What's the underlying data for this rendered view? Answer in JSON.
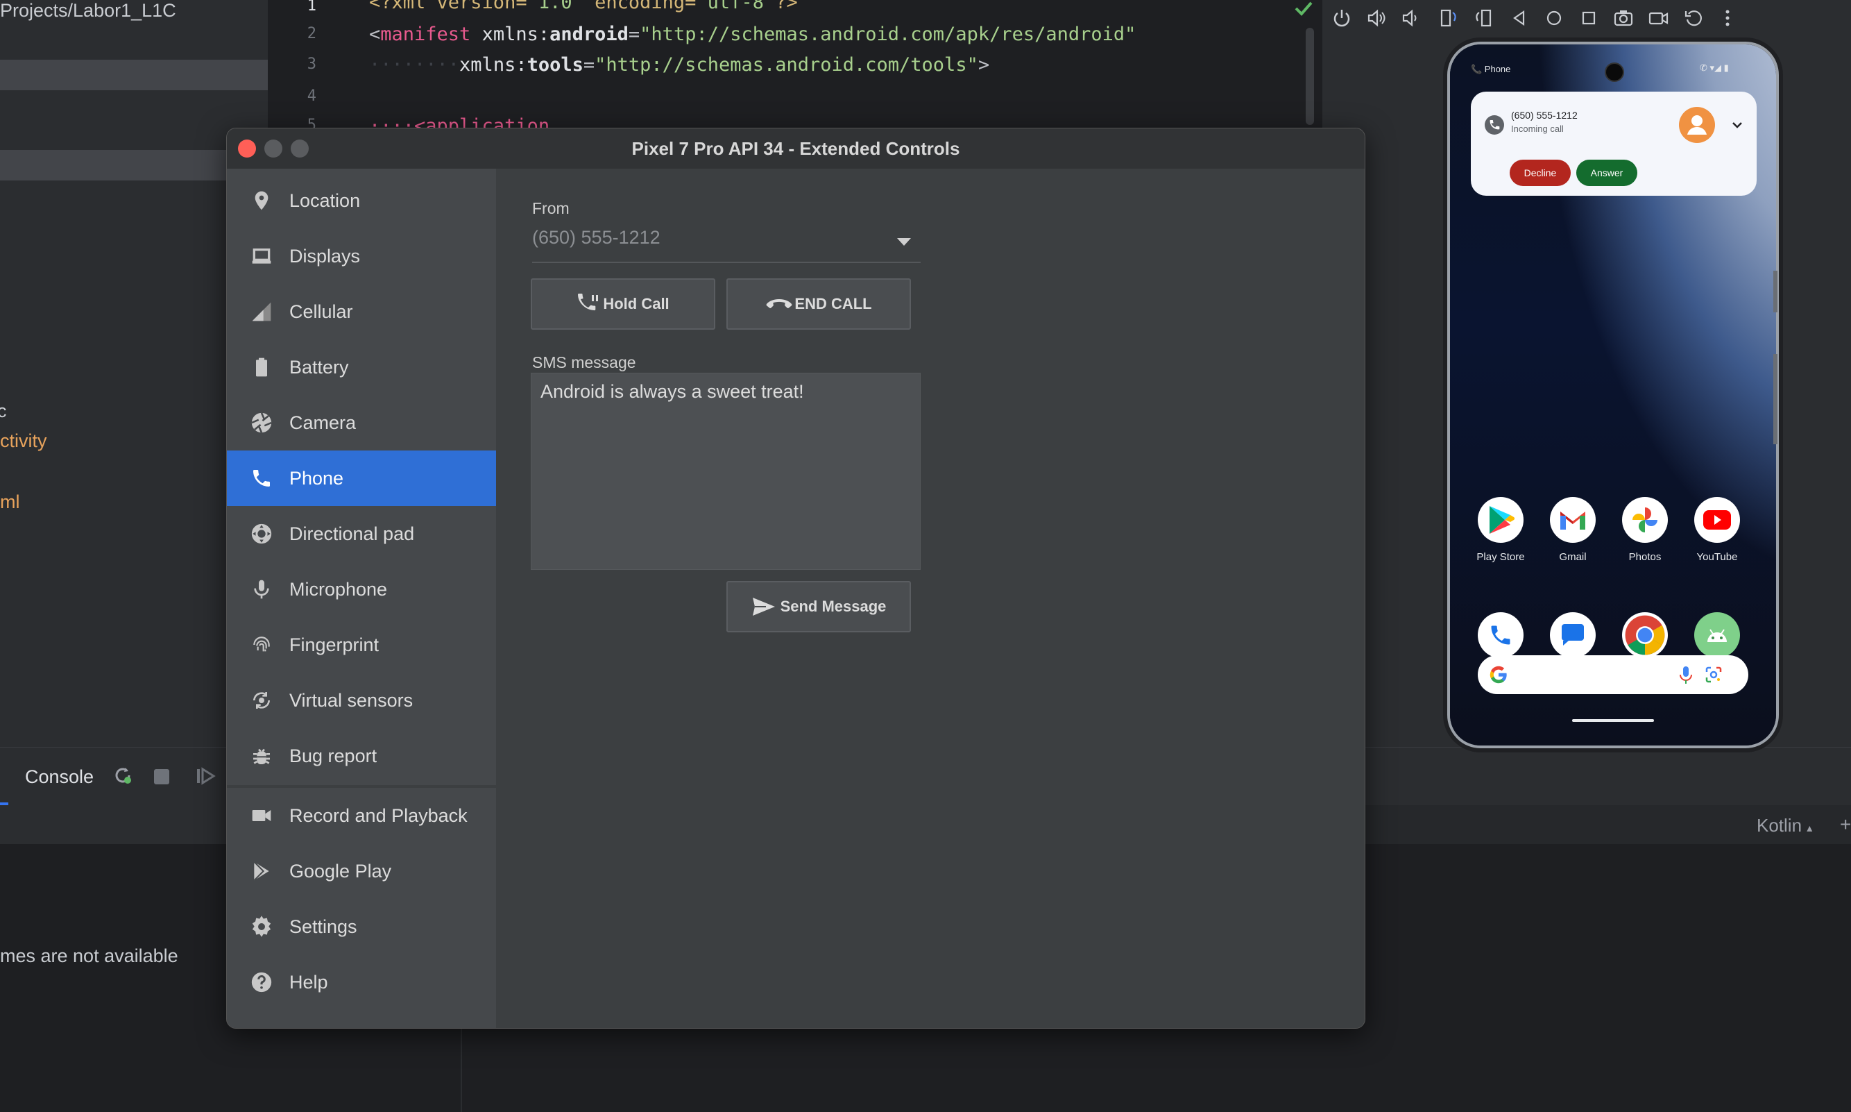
{
  "ide": {
    "project_path": "Projects/Labor1_L1C",
    "tree_c": "c",
    "tree_activity": "ctivity",
    "tree_ml": "ml",
    "console_tab": "Console",
    "frames_message": "mes are not available",
    "language_label": "Kotlin",
    "language_arrow": "▴",
    "code_lines": [
      {
        "n": "1"
      },
      {
        "n": "2"
      },
      {
        "n": "3"
      },
      {
        "n": "4"
      },
      {
        "n": "5"
      }
    ],
    "code": {
      "l1_a": "<?xml version=",
      "l1_b": "\"1.0\"",
      "l1_c": " encoding=",
      "l1_d": "\"utf-8\"",
      "l1_e": "?>",
      "l2_a": "<",
      "l2_b": "manifest",
      "l2_c": " xmlns:",
      "l2_d": "android",
      "l2_e": "=",
      "l2_f": "\"http://schemas.android.com/apk/res/android\"",
      "l3_dots": "········",
      "l3_a": "xmlns:",
      "l3_b": "tools",
      "l3_c": "=",
      "l3_d": "\"http://schemas.android.com/tools\"",
      "l3_e": ">",
      "l5_a": "····<application"
    }
  },
  "window": {
    "title": "Pixel 7 Pro API 34 - Extended Controls"
  },
  "sidebar": {
    "items": [
      {
        "label": "Location",
        "icon": "location-pin-icon"
      },
      {
        "label": "Displays",
        "icon": "display-icon"
      },
      {
        "label": "Cellular",
        "icon": "signal-icon"
      },
      {
        "label": "Battery",
        "icon": "battery-icon"
      },
      {
        "label": "Camera",
        "icon": "camera-aperture-icon"
      },
      {
        "label": "Phone",
        "icon": "phone-icon",
        "active": true
      },
      {
        "label": "Directional pad",
        "icon": "dpad-icon"
      },
      {
        "label": "Microphone",
        "icon": "microphone-icon"
      },
      {
        "label": "Fingerprint",
        "icon": "fingerprint-icon"
      },
      {
        "label": "Virtual sensors",
        "icon": "rotate-icon"
      },
      {
        "label": "Bug report",
        "icon": "bug-icon"
      },
      {
        "label": "Record and Playback",
        "icon": "videocam-icon"
      },
      {
        "label": "Google Play",
        "icon": "play-icon"
      },
      {
        "label": "Settings",
        "icon": "gear-icon"
      },
      {
        "label": "Help",
        "icon": "help-icon"
      }
    ]
  },
  "phone_panel": {
    "from_label": "From",
    "from_value": "(650) 555-1212",
    "hold_call": "Hold Call",
    "end_call": "END CALL",
    "sms_label": "SMS message",
    "sms_text": "Android is always a sweet treat!",
    "send_message": "Send Message"
  },
  "device": {
    "status_app": "📞 Phone",
    "status_icons": "✆ ▾◢ ▮",
    "notification": {
      "number": "(650) 555-1212",
      "subtitle": "Incoming call",
      "decline": "Decline",
      "answer": "Answer"
    },
    "apps": [
      {
        "label": "Play Store"
      },
      {
        "label": "Gmail"
      },
      {
        "label": "Photos"
      },
      {
        "label": "YouTube"
      }
    ],
    "dock": [
      "phone-app-icon",
      "messages-app-icon",
      "chrome-app-icon",
      "android-app-icon"
    ]
  },
  "colors": {
    "accent": "#2f6fd6",
    "decline": "#b3261e",
    "answer": "#146c2e"
  }
}
